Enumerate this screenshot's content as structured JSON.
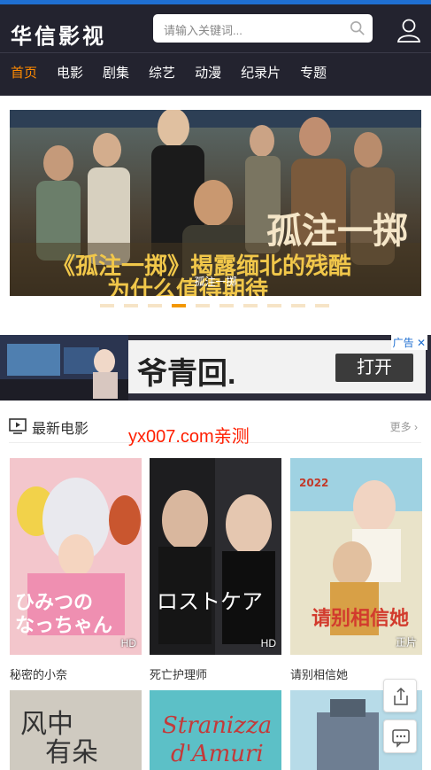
{
  "header": {
    "logo": "华信影视",
    "search_placeholder": "请输入关键词...",
    "nav": [
      "首页",
      "电影",
      "剧集",
      "综艺",
      "动漫",
      "纪录片",
      "专题"
    ],
    "active_nav": "首页"
  },
  "banner": {
    "title": "孤注一掷",
    "slide_count": 10,
    "active_index": 3
  },
  "ad": {
    "text": "爷青回.",
    "button": "打开",
    "tag": "广告"
  },
  "section": {
    "title": "最新电影",
    "more": "更多",
    "watermark": "yx007.com亲测"
  },
  "movies": [
    {
      "title": "秘密的小奈",
      "badge": "HD"
    },
    {
      "title": "死亡护理师",
      "badge": "HD"
    },
    {
      "title": "请别相信她",
      "badge": "正片"
    }
  ],
  "colors": {
    "accent": "#ff8a00",
    "header_bg": "#23232f",
    "top_stripe": "#1f6fd1"
  }
}
